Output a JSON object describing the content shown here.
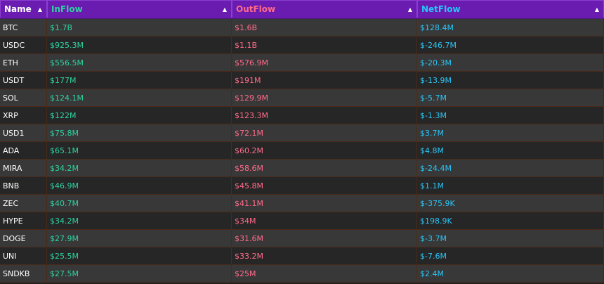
{
  "colors": {
    "header_bg": "#6a1bb0",
    "name_header": "#ffffff",
    "inflow": "#2ed3a0",
    "outflow": "#ff6b8a",
    "netflow": "#29c5f6",
    "name_text": "#ffffff",
    "row_odd": "#383838",
    "row_even": "#262626"
  },
  "header": {
    "name": "Name",
    "inflow": "InFlow",
    "outflow": "OutFlow",
    "netflow": "NetFlow",
    "sort_icon": "sort-asc-icon",
    "sort_glyph": "▲"
  },
  "rows": [
    {
      "name": "BTC",
      "inflow": "$1.7B",
      "outflow": "$1.6B",
      "netflow": "$128.4M"
    },
    {
      "name": "USDC",
      "inflow": "$925.3M",
      "outflow": "$1.1B",
      "netflow": "$-246.7M"
    },
    {
      "name": "ETH",
      "inflow": "$556.5M",
      "outflow": "$576.9M",
      "netflow": "$-20.3M"
    },
    {
      "name": "USDT",
      "inflow": "$177M",
      "outflow": "$191M",
      "netflow": "$-13.9M"
    },
    {
      "name": "SOL",
      "inflow": "$124.1M",
      "outflow": "$129.9M",
      "netflow": "$-5.7M"
    },
    {
      "name": "XRP",
      "inflow": "$122M",
      "outflow": "$123.3M",
      "netflow": "$-1.3M"
    },
    {
      "name": "USD1",
      "inflow": "$75.8M",
      "outflow": "$72.1M",
      "netflow": "$3.7M"
    },
    {
      "name": "ADA",
      "inflow": "$65.1M",
      "outflow": "$60.2M",
      "netflow": "$4.8M"
    },
    {
      "name": "MIRA",
      "inflow": "$34.2M",
      "outflow": "$58.6M",
      "netflow": "$-24.4M"
    },
    {
      "name": "BNB",
      "inflow": "$46.9M",
      "outflow": "$45.8M",
      "netflow": "$1.1M"
    },
    {
      "name": "ZEC",
      "inflow": "$40.7M",
      "outflow": "$41.1M",
      "netflow": "$-375.9K"
    },
    {
      "name": "HYPE",
      "inflow": "$34.2M",
      "outflow": "$34M",
      "netflow": "$198.9K"
    },
    {
      "name": "DOGE",
      "inflow": "$27.9M",
      "outflow": "$31.6M",
      "netflow": "$-3.7M"
    },
    {
      "name": "UNI",
      "inflow": "$25.5M",
      "outflow": "$33.2M",
      "netflow": "$-7.6M"
    },
    {
      "name": "SNDKB",
      "inflow": "$27.5M",
      "outflow": "$25M",
      "netflow": "$2.4M"
    }
  ]
}
